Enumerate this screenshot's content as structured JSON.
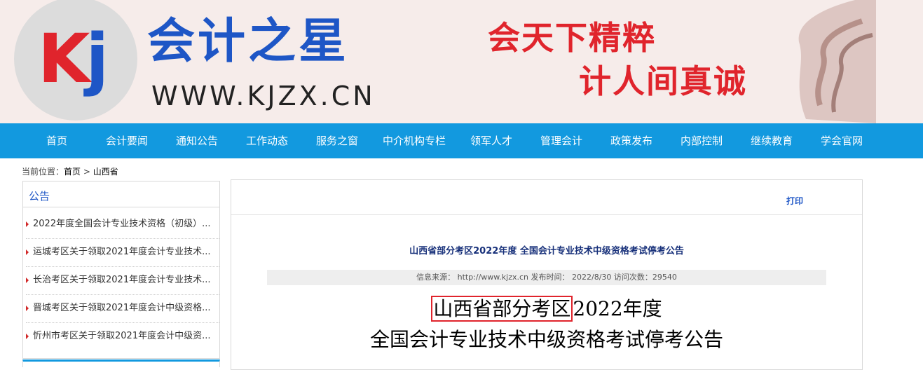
{
  "banner": {
    "logo_letters_k": "K",
    "logo_letters_j": "j",
    "site_name": "会计之星",
    "site_url": "WWW.KJZX.CN",
    "slogan_line1": "会天下精粹",
    "slogan_line2": "计人间真诚"
  },
  "nav": {
    "items": [
      "首页",
      "会计要闻",
      "通知公告",
      "工作动态",
      "服务之窗",
      "中介机构专栏",
      "领军人才",
      "管理会计",
      "政策发布",
      "内部控制",
      "继续教育",
      "学会官网"
    ]
  },
  "breadcrumb": {
    "prefix": "当前位置：",
    "home": "首页",
    "separator": " > ",
    "current": "山西省"
  },
  "sidebar": {
    "title": "公告",
    "items": [
      "2022年度全国会计专业技术资格（初级）...",
      "运城考区关于领取2021年度会计专业技术...",
      "长治考区关于领取2021年度会计专业技术...",
      "晋城考区关于领取2021年度会计中级资格...",
      "忻州市考区关于领取2021年度会计中级资..."
    ]
  },
  "article": {
    "print_label": "打印",
    "title": "山西省部分考区2022年度 全国会计专业技术中级资格考试停考公告",
    "meta": "信息来源： http://www.kjzx.cn 发布时间： 2022/8/30 访问次数：29540",
    "heading_highlight": "山西省部分考区",
    "heading_rest": "2022年度",
    "heading_line2": "全国会计专业技术中级资格考试停考公告"
  },
  "colors": {
    "nav_bg": "#1299df",
    "brand_blue": "#1e56c6",
    "brand_red": "#e0242c",
    "banner_bg": "#f6ecea"
  }
}
